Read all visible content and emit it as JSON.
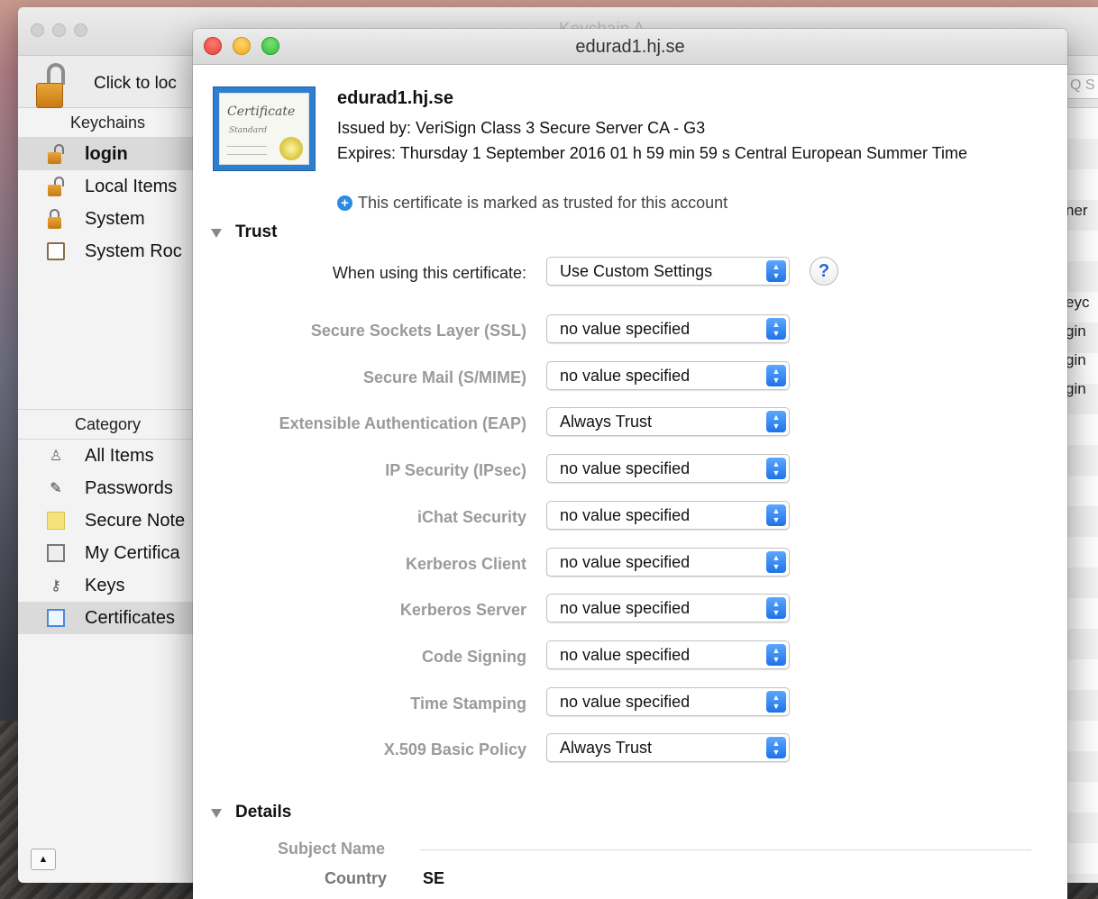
{
  "background_window": {
    "title": "Keychain A",
    "lock_label": "Click to loc",
    "search_placeholder": "Q S",
    "keychains_header": "Keychains",
    "keychains": [
      {
        "label": "login",
        "icon": "open-lock-icon"
      },
      {
        "label": "Local Items",
        "icon": "open-lock-icon"
      },
      {
        "label": "System",
        "icon": "closed-lock-icon"
      },
      {
        "label": "System Roc",
        "icon": "cabinet-icon"
      }
    ],
    "category_header": "Category",
    "categories": [
      {
        "label": "All Items",
        "icon": "people-icon"
      },
      {
        "label": "Passwords",
        "icon": "pen-icon"
      },
      {
        "label": "Secure Note",
        "icon": "note-icon"
      },
      {
        "label": "My Certifica",
        "icon": "certificate-icon"
      },
      {
        "label": "Keys",
        "icon": "key-icon"
      },
      {
        "label": "Certificates",
        "icon": "certificate-icon"
      }
    ],
    "right_column_fragments": [
      "ner",
      "eyc",
      "gin",
      "gin",
      "gin"
    ]
  },
  "cert_window": {
    "title": "edurad1.hj.se",
    "cert_name": "edurad1.hj.se",
    "issued_by": "Issued by: VeriSign Class 3 Secure Server CA - G3",
    "expires": "Expires: Thursday 1 September 2016 01 h 59 min 59 s Central European Summer Time",
    "trusted_note": "This certificate is marked as trusted for this account",
    "thumb_script": "Certificate",
    "thumb_sub": "Standard",
    "trust_section": "Trust",
    "when_using_label": "When using this certificate:",
    "when_using_value": "Use Custom Settings",
    "help_label": "?",
    "policies": [
      {
        "label": "Secure Sockets Layer (SSL)",
        "value": "no value specified"
      },
      {
        "label": "Secure Mail (S/MIME)",
        "value": "no value specified"
      },
      {
        "label": "Extensible Authentication (EAP)",
        "value": "Always Trust"
      },
      {
        "label": "IP Security (IPsec)",
        "value": "no value specified"
      },
      {
        "label": "iChat Security",
        "value": "no value specified"
      },
      {
        "label": "Kerberos Client",
        "value": "no value specified"
      },
      {
        "label": "Kerberos Server",
        "value": "no value specified"
      },
      {
        "label": "Code Signing",
        "value": "no value specified"
      },
      {
        "label": "Time Stamping",
        "value": "no value specified"
      },
      {
        "label": "X.509 Basic Policy",
        "value": "Always Trust"
      }
    ],
    "details_section": "Details",
    "subject_name_label": "Subject Name",
    "country_label": "Country",
    "country_value": "SE"
  }
}
